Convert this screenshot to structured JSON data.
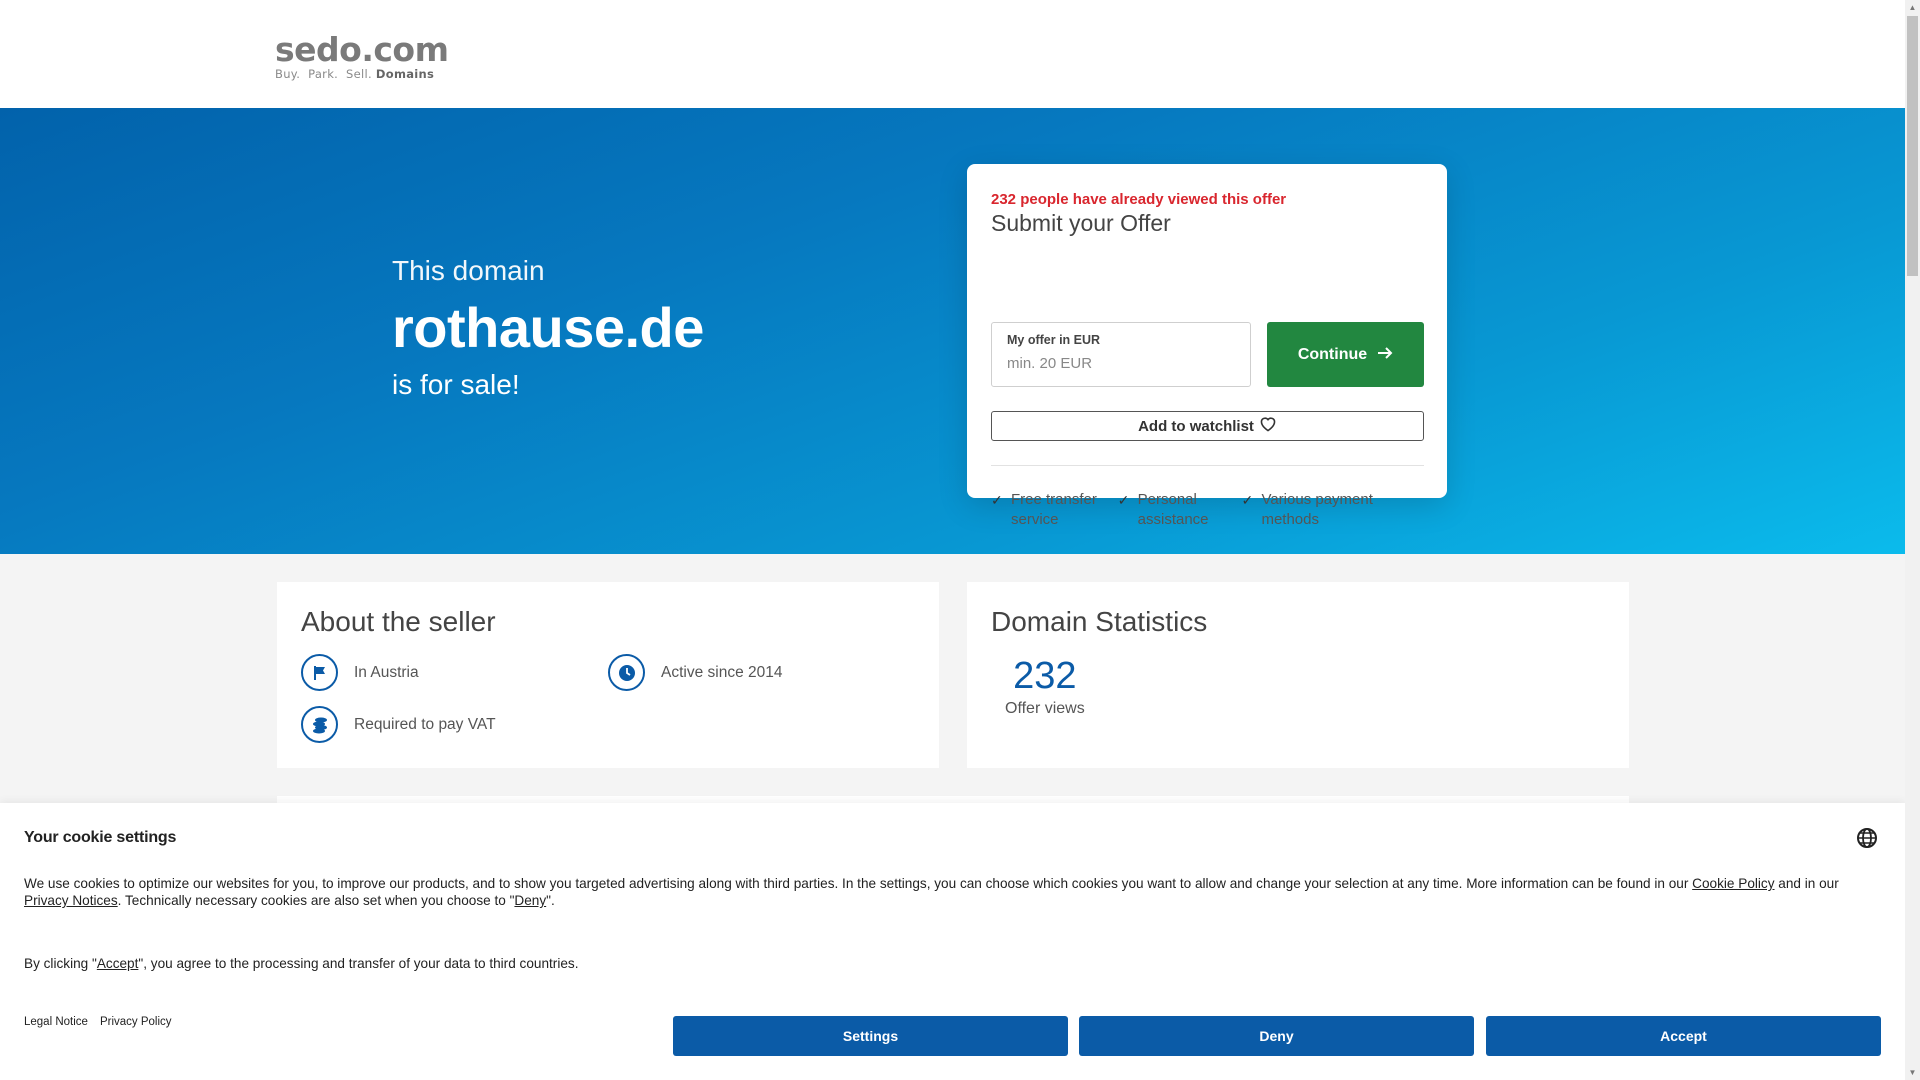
{
  "header": {
    "logo_main": "sedo.com",
    "logo_tag_light": "Buy.  Park.  Sell.",
    "logo_tag_bold": "Domains"
  },
  "hero": {
    "pre": "This domain",
    "domain": "rothause.de",
    "post": "is for sale!"
  },
  "offer": {
    "viewed_notice": "232 people have already viewed this offer",
    "title": "Submit your Offer",
    "input_label": "My offer in EUR",
    "input_placeholder": "min. 20 EUR",
    "input_value": "",
    "continue_label": "Continue",
    "watchlist_label": "Add to watchlist",
    "features": [
      {
        "label": "Free transfer service"
      },
      {
        "label": "Personal assistance"
      },
      {
        "label": "Various payment methods"
      }
    ],
    "colors": {
      "notice": "#d9262e",
      "continue": "#228740"
    }
  },
  "seller": {
    "heading": "About the seller",
    "items": [
      {
        "icon": "flag-icon",
        "label": "In Austria"
      },
      {
        "icon": "clock-icon",
        "label": "Active since 2014"
      },
      {
        "icon": "coins-icon",
        "label": "Required to pay VAT"
      }
    ]
  },
  "stats": {
    "heading": "Domain Statistics",
    "offer_views": "232",
    "offer_views_label": "Offer views"
  },
  "cookie": {
    "title": "Your cookie settings",
    "text_1": "We use cookies to optimize our websites for you, to improve our products, and to show you targeted advertising along with third parties. In the settings, you can choose which cookies you want to allow and change your selection at any time. More information can be found in our ",
    "cookie_policy_link": "Cookie Policy",
    "text_2": " and in our ",
    "privacy_notices_link": "Privacy Notices",
    "text_3": ". Technically necessary cookies are also set when you choose to \"",
    "deny_link": "Deny",
    "text_4": "\".",
    "accept_text_1": "By clicking \"",
    "accept_link": "Accept",
    "accept_text_2": "\", you agree to the processing and transfer of your data to third countries.",
    "legal_notice": "Legal Notice",
    "privacy_policy": "Privacy Policy",
    "settings_label": "Settings",
    "deny_label": "Deny",
    "accept_label": "Accept",
    "button_color": "#0b5ba7"
  }
}
